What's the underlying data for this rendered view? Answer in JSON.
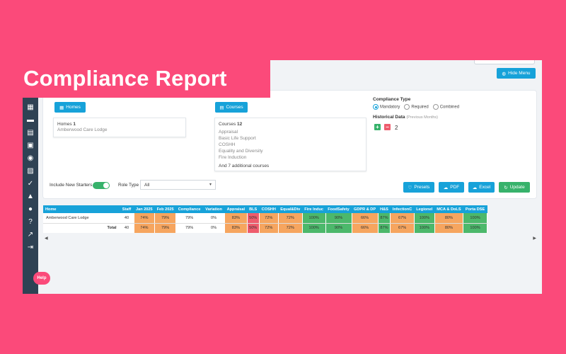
{
  "hero": {
    "title": "Compliance Report"
  },
  "header": {
    "hide_menu_label": "Hide Menu"
  },
  "sidebar": {
    "icons": [
      "calendar-icon",
      "folder-icon",
      "clipboard-icon",
      "certificate-icon",
      "users-icon",
      "book-icon",
      "check-circle-icon",
      "flask-icon",
      "user-icon",
      "question-icon",
      "trend-icon",
      "logout-icon"
    ],
    "help_label": "Help"
  },
  "homes": {
    "button_label": "Homes",
    "heading": "Homes",
    "count": "1",
    "items": [
      "Amberwood Care Lodge"
    ]
  },
  "courses": {
    "button_label": "Courses",
    "heading": "Courses",
    "count": "12",
    "items": [
      "Appraisal",
      "Basic Life Support",
      "COSHH",
      "Equality and Diversity",
      "Fire Induction"
    ],
    "more_text": "And 7 additional courses"
  },
  "compliance_type": {
    "title": "Compliance Type",
    "options": [
      "Mandatory",
      "Required",
      "Combined"
    ],
    "selected": "Mandatory"
  },
  "historical": {
    "title": "Historical Data",
    "hint": "(Previous Months)",
    "value": "2"
  },
  "filters": {
    "include_new_starters_label": "Include New Starters",
    "role_type_label": "Role Type",
    "role_type_value": "All"
  },
  "actions": {
    "presets": "Presets",
    "pdf": "PDF",
    "excel": "Excel",
    "update": "Update"
  },
  "colors": {
    "accent": "#17a2d9",
    "brand": "#fb4a7a",
    "sidebar": "#2f4254",
    "good": "#4cb86b",
    "warn": "#f6a55f",
    "bad": "#ee5c6d",
    "neutral": "#ffffff"
  },
  "table": {
    "columns": [
      "Home",
      "Staff",
      "Jan 2025",
      "Feb 2025",
      "Compliance",
      "Variation",
      "Appraisal",
      "BLS",
      "COSHH",
      "Equal&Div",
      "Fire Induc",
      "FoodSafety",
      "GDPR & DP",
      "H&S",
      "InfectionC",
      "Legionel",
      "MCA & DoLS",
      "Porta DSE"
    ],
    "rows": [
      {
        "name": "Amberwood Care Lodge",
        "kind": "data",
        "cells": [
          "40",
          "74%",
          "79%",
          "79%",
          "0%",
          "83%",
          "50%",
          "72%",
          "72%",
          "100%",
          "90%",
          "66%",
          "87%",
          "67%",
          "100%",
          "80%",
          "100%"
        ],
        "status": [
          "neutral",
          "warn",
          "warn",
          "neutral",
          "neutral",
          "warn",
          "bad",
          "warn",
          "warn",
          "good",
          "good",
          "warn",
          "good",
          "warn",
          "good",
          "warn",
          "good"
        ]
      },
      {
        "name": "Total",
        "kind": "total",
        "cells": [
          "40",
          "74%",
          "79%",
          "79%",
          "0%",
          "83%",
          "50%",
          "72%",
          "72%",
          "100%",
          "90%",
          "66%",
          "87%",
          "67%",
          "100%",
          "80%",
          "100%"
        ],
        "status": [
          "neutral",
          "warn",
          "warn",
          "neutral",
          "neutral",
          "warn",
          "bad",
          "warn",
          "warn",
          "good",
          "good",
          "warn",
          "good",
          "warn",
          "good",
          "warn",
          "good"
        ]
      }
    ]
  }
}
